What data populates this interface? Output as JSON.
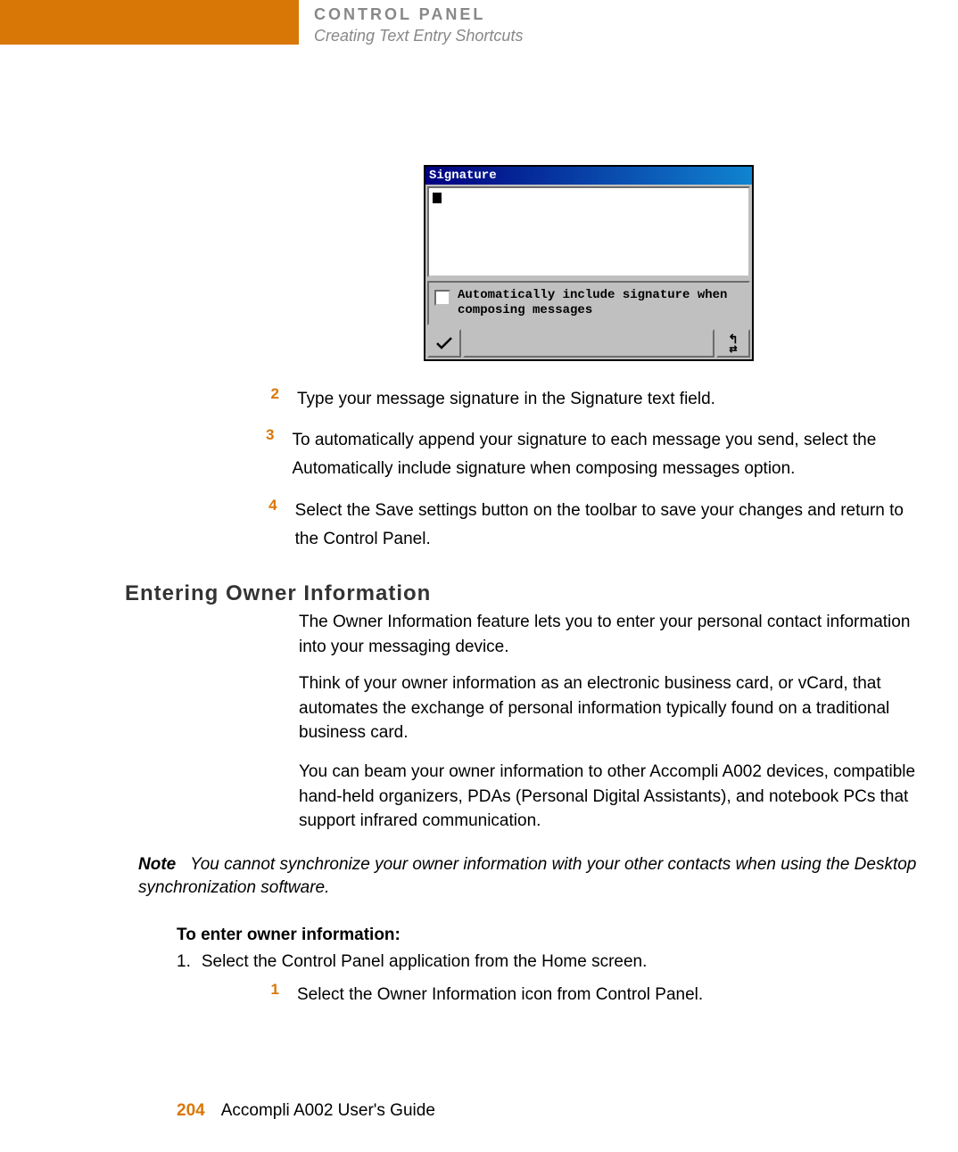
{
  "header": {
    "tab_color": "#d97706",
    "title": "CONTROL PANEL",
    "subtitle": "Creating Text Entry Shortcuts"
  },
  "screenshot": {
    "titlebar": "Signature",
    "checkbox_label": "Automatically include signature when composing messages",
    "save_icon": "check-icon",
    "back_icon": "return-arrow-icon",
    "swap_icon": "swap-arrow-icon"
  },
  "steps": [
    {
      "num": "2",
      "text": "Type your message signature in the Signature text field."
    },
    {
      "num": "3",
      "text": "To automatically append your signature to each message you send, select the Automatically include signature when composing messages option."
    },
    {
      "num": "4",
      "text": "Select the Save settings button on the toolbar to save your changes and return to the Control Panel."
    }
  ],
  "section": {
    "heading": "Entering Owner Information",
    "para1": "The Owner Information feature lets you to enter your personal contact information into your messaging device.",
    "para2": "Think of your owner information as an electronic business card, or vCard, that automates the exchange of personal information typically found on a traditional business card.",
    "para3": "You can beam your owner information to other Accompli A002 devices, compatible hand-held organizers, PDAs (Personal Digital Assistants), and notebook PCs that support infrared communication."
  },
  "note": {
    "label": "Note",
    "text": "You cannot synchronize your owner information with your other contacts when using the Desktop synchronization software."
  },
  "enter_owner": {
    "heading": "To enter owner information:",
    "outer_step_num": "1.",
    "outer_step_text": "Select the Control Panel application from the Home screen.",
    "inner_step_num": "1",
    "inner_step_text": "Select the Owner Information icon from Control Panel."
  },
  "footer": {
    "page": "204",
    "guide": "Accompli A002 User's Guide"
  }
}
